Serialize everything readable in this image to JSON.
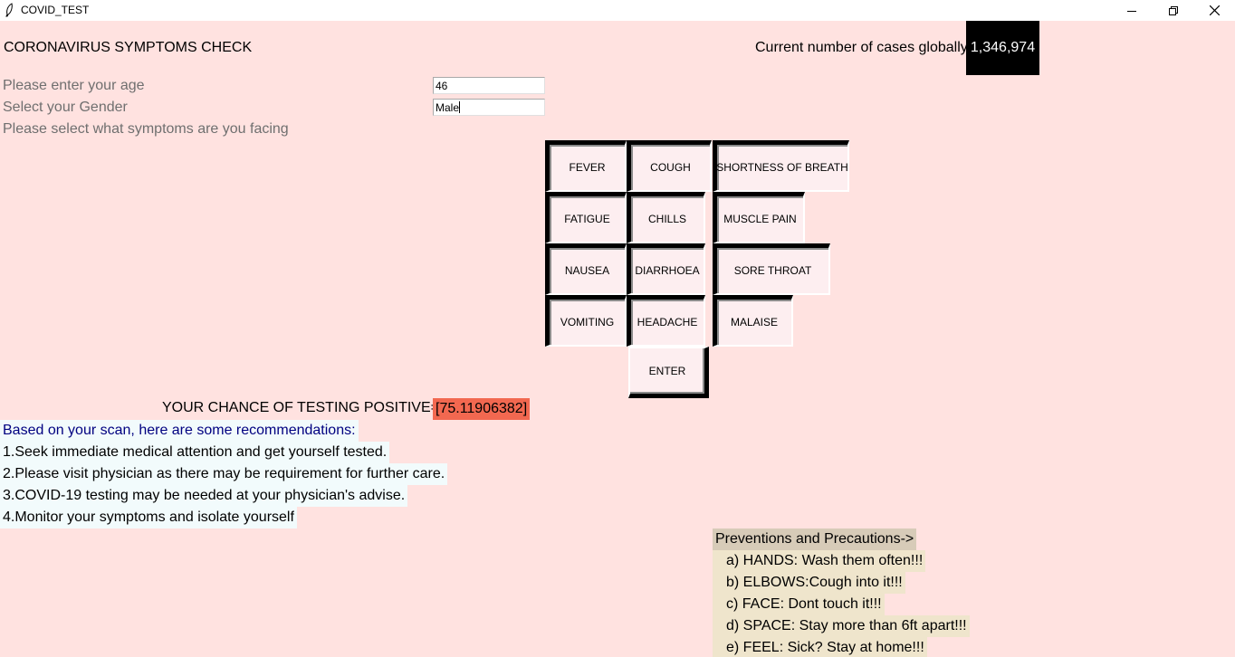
{
  "window": {
    "title": "COVID_TEST"
  },
  "header": {
    "title": "CORONAVIRUS SYMPTOMS CHECK",
    "cases_label": "Current number of cases globally:",
    "cases_value": "1,346,974"
  },
  "form": {
    "age_label": "Please enter your age",
    "age_value": "46",
    "gender_label": "Select your Gender",
    "gender_value": "Male",
    "symptoms_label": "Please select what symptoms are you facing"
  },
  "symptoms": [
    {
      "label": "FEVER",
      "selected": true
    },
    {
      "label": "COUGH",
      "selected": true
    },
    {
      "label": "SHORTNESS OF BREATH",
      "selected": true
    },
    {
      "label": "FATIGUE",
      "selected": true
    },
    {
      "label": "CHILLS",
      "selected": true
    },
    {
      "label": "MUSCLE PAIN",
      "selected": true
    },
    {
      "label": "NAUSEA",
      "selected": true
    },
    {
      "label": "DIARRHOEA",
      "selected": true
    },
    {
      "label": "SORE THROAT",
      "selected": true
    },
    {
      "label": "VOMITING",
      "selected": true
    },
    {
      "label": "HEADACHE",
      "selected": true
    },
    {
      "label": "MALAISE",
      "selected": true
    }
  ],
  "enter_button": "ENTER",
  "result": {
    "label": "YOUR CHANCE OF TESTING POSITIVE=",
    "value": "[75.11906382]"
  },
  "recommendations": {
    "heading": "Based on your scan, here are some recommendations:",
    "items": [
      "1.Seek immediate medical attention and get yourself tested.",
      "2.Please visit physician as there may be requirement for further care.",
      "3.COVID-19 testing may be needed at your physician's advise.",
      "4.Monitor your symptoms and isolate yourself"
    ]
  },
  "preventions": {
    "heading": "Preventions and Precautions->",
    "items": [
      "a) HANDS: Wash them often!!!",
      "b) ELBOWS:Cough into it!!!",
      "c) FACE: Dont touch it!!!",
      "d) SPACE: Stay more than 6ft apart!!!",
      "e) FEEL: Sick? Stay at home!!!"
    ]
  },
  "colors": {
    "background": "#ffe2e0",
    "result_highlight": "#f26850",
    "cases_bg": "#000000",
    "recommendation_bg": "#f2fbfc",
    "prevention_heading_bg": "#d7cbb8",
    "prevention_bg": "#efe5cc"
  }
}
